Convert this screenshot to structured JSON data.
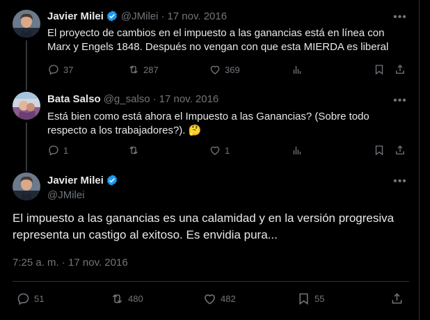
{
  "colors": {
    "background": "#000000",
    "text": "#e7e9ea",
    "muted": "#71767b",
    "verified": "#1d9bf0",
    "border": "#2f3336"
  },
  "tweets": [
    {
      "name": "Javier Milei",
      "verified": true,
      "handle": "@JMilei",
      "dot": "·",
      "date": "17 nov. 2016",
      "text": "El proyecto de cambios en el impuesto a las ganancias está en línea con Marx y Engels 1848. Después no vengan con que esta MIERDA es liberal",
      "replies": "37",
      "retweets": "287",
      "likes": "369"
    },
    {
      "name": "Bata Salso",
      "verified": false,
      "handle": "@g_salso",
      "dot": "·",
      "date": "17 nov. 2016",
      "text": "Está bien como está ahora el Impuesto a las Ganancias? (Sobre todo respecto a los trabajadores?). 🤔",
      "replies": "1",
      "retweets": "",
      "likes": "1"
    }
  ],
  "main_tweet": {
    "name": "Javier Milei",
    "verified": true,
    "handle": "@JMilei",
    "text": "El impuesto a las ganancias es una calamidad y en la versión progresiva representa un castigo al exitoso. Es envidia pura...",
    "timestamp": "7:25 a. m. · 17 nov. 2016",
    "replies": "51",
    "retweets": "480",
    "likes": "482",
    "bookmarks": "55"
  },
  "icons": [
    "more-icon",
    "reply-icon",
    "retweet-icon",
    "like-icon",
    "views-icon",
    "bookmark-icon",
    "share-icon",
    "verified-icon"
  ]
}
